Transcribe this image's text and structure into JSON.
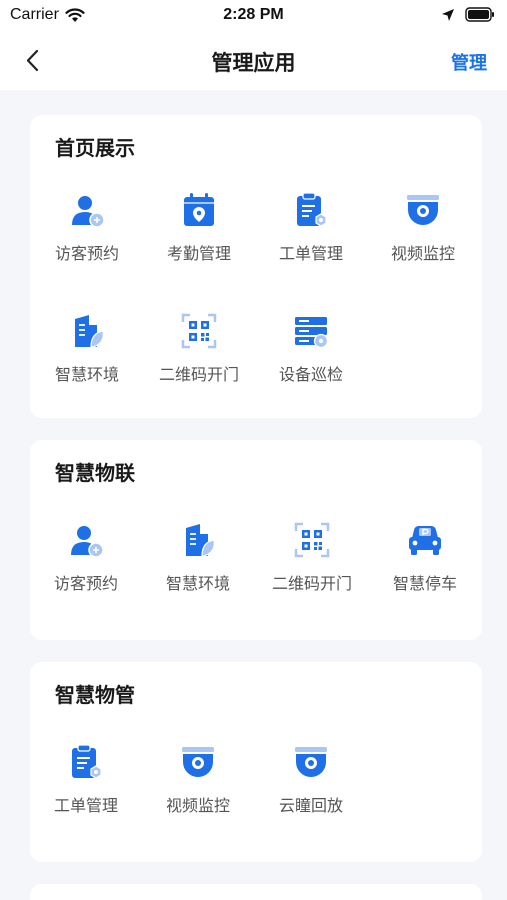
{
  "status_bar": {
    "carrier": "Carrier",
    "time": "2:28 PM"
  },
  "nav": {
    "title": "管理应用",
    "action_label": "管理"
  },
  "colors": {
    "accent": "#1a73e8",
    "icon_blue": "#1f6fe6",
    "icon_light": "#a9c6f5"
  },
  "sections": [
    {
      "title": "首页展示",
      "apps": [
        {
          "label": "访客预约",
          "icon": "visitor-icon"
        },
        {
          "label": "考勤管理",
          "icon": "attendance-icon"
        },
        {
          "label": "工单管理",
          "icon": "work-order-icon"
        },
        {
          "label": "视频监控",
          "icon": "camera-icon"
        },
        {
          "label": "智慧环境",
          "icon": "building-icon"
        },
        {
          "label": "二维码开门",
          "icon": "qrcode-icon"
        },
        {
          "label": "设备巡检",
          "icon": "device-inspection-icon"
        }
      ]
    },
    {
      "title": "智慧物联",
      "apps": [
        {
          "label": "访客预约",
          "icon": "visitor-icon"
        },
        {
          "label": "智慧环境",
          "icon": "building-icon"
        },
        {
          "label": "二维码开门",
          "icon": "qrcode-icon"
        },
        {
          "label": "智慧停车",
          "icon": "parking-car-icon"
        }
      ]
    },
    {
      "title": "智慧物管",
      "apps": [
        {
          "label": "工单管理",
          "icon": "work-order-icon"
        },
        {
          "label": "视频监控",
          "icon": "camera-icon"
        },
        {
          "label": "云瞳回放",
          "icon": "camera-icon"
        }
      ]
    }
  ]
}
